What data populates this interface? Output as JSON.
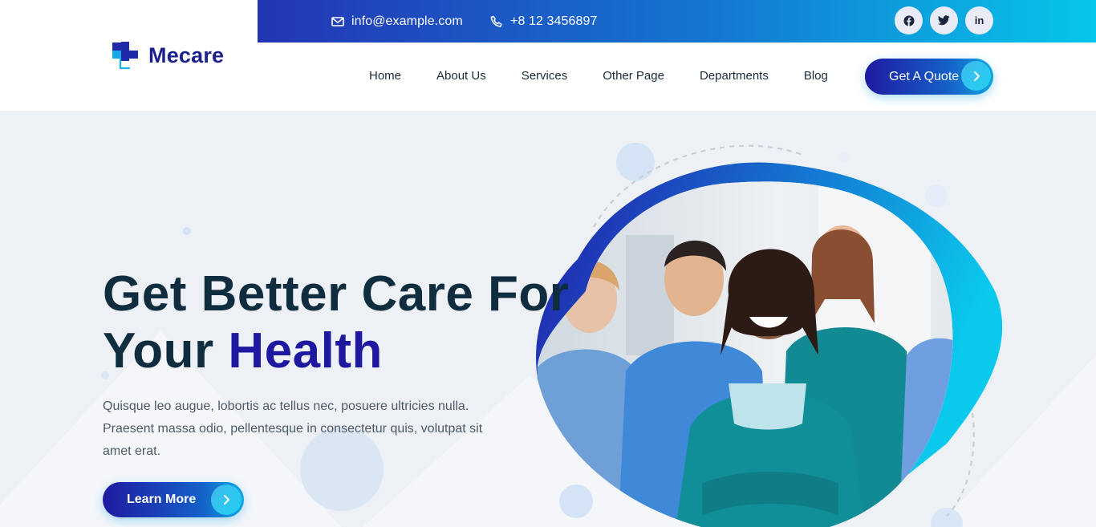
{
  "topbar": {
    "email": "info@example.com",
    "phone": "+8 12 3456897",
    "socials": [
      {
        "name": "facebook",
        "label": "f"
      },
      {
        "name": "twitter",
        "label": "t"
      },
      {
        "name": "linkedin",
        "label": "in"
      }
    ]
  },
  "brand": {
    "name": "Mecare"
  },
  "nav": {
    "items": [
      {
        "label": "Home"
      },
      {
        "label": "About Us"
      },
      {
        "label": "Services"
      },
      {
        "label": "Other Page"
      },
      {
        "label": "Departments"
      },
      {
        "label": "Blog"
      }
    ],
    "cta_label": "Get A Quote"
  },
  "hero": {
    "title_line1": "Get Better Care For",
    "title_line2_prefix": "Your",
    "title_line2_accent": "Health",
    "description": "Quisque leo augue, lobortis ac tellus nec, posuere ultricies nulla. Praesent massa odio, pellentesque in consectetur quis, volutpat sit amet erat.",
    "button_label": "Learn More"
  },
  "colors": {
    "brand_dark": "#1e17a0",
    "brand_light": "#06c6ea",
    "heading": "#0f2d3f",
    "hero_bg": "#edf0f5"
  }
}
